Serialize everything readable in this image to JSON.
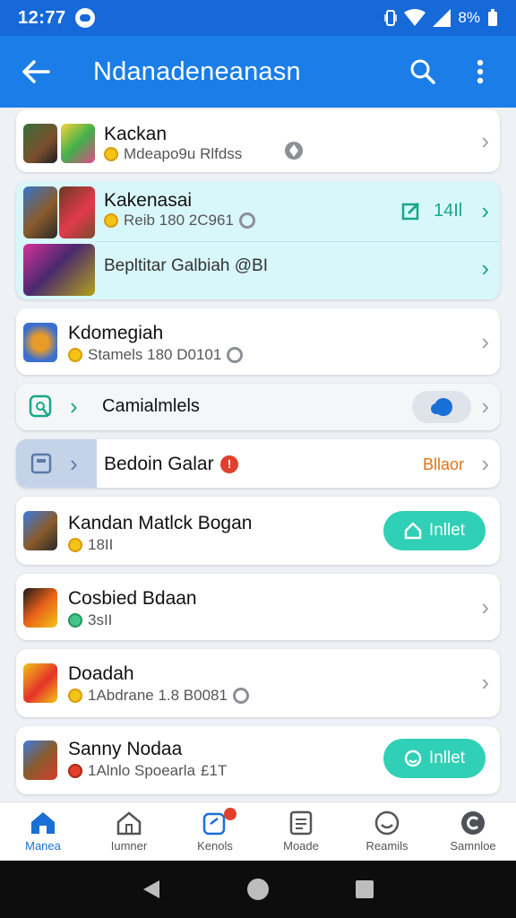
{
  "status_bar": {
    "time": "12:77",
    "battery": "8%"
  },
  "app_bar": {
    "title": "Ndanadeneanasn"
  },
  "rows": [
    {
      "title": "Kackan",
      "subtitle": "Mdeapo9u Rlfdss"
    },
    {
      "title": "Kakenasai",
      "subtitle": "Reib 180 2C961",
      "count": "14Il",
      "title2": "Bepltitar Galbiah @BI"
    },
    {
      "title": "Kdomegiah",
      "subtitle": "Stamels 180 D0101"
    },
    {
      "title": "Camialmlels"
    },
    {
      "title": "Bedoin Galar",
      "action": "Bllaor"
    },
    {
      "title": "Kandan Matlck Bogan",
      "subtitle": "18II",
      "button": "Inllet"
    },
    {
      "title": "Cosbied Bdaan",
      "subtitle": "3sII"
    },
    {
      "title": "Doadah",
      "subtitle": "1Abdrane 1.8 B0081"
    },
    {
      "title": "Sanny Nodaa",
      "subtitle": "1Alnlo Spoearla",
      "subtitle_suffix": "£1T",
      "button": "Inllet"
    }
  ],
  "bottom_nav": [
    {
      "label": "Manea",
      "icon": "home-icon",
      "active": true
    },
    {
      "label": "Iumner",
      "icon": "house-outline-icon"
    },
    {
      "label": "Kenols",
      "icon": "notification-icon"
    },
    {
      "label": "Moade",
      "icon": "document-icon"
    },
    {
      "label": "Reamils",
      "icon": "smiley-icon"
    },
    {
      "label": "Samnloe",
      "icon": "profile-icon"
    }
  ],
  "colors": {
    "appbar": "#1a7de8",
    "statusbar": "#1569d9",
    "accent": "#2fd0b5",
    "highlight": "#d8f7fb",
    "orange": "#e07316"
  }
}
